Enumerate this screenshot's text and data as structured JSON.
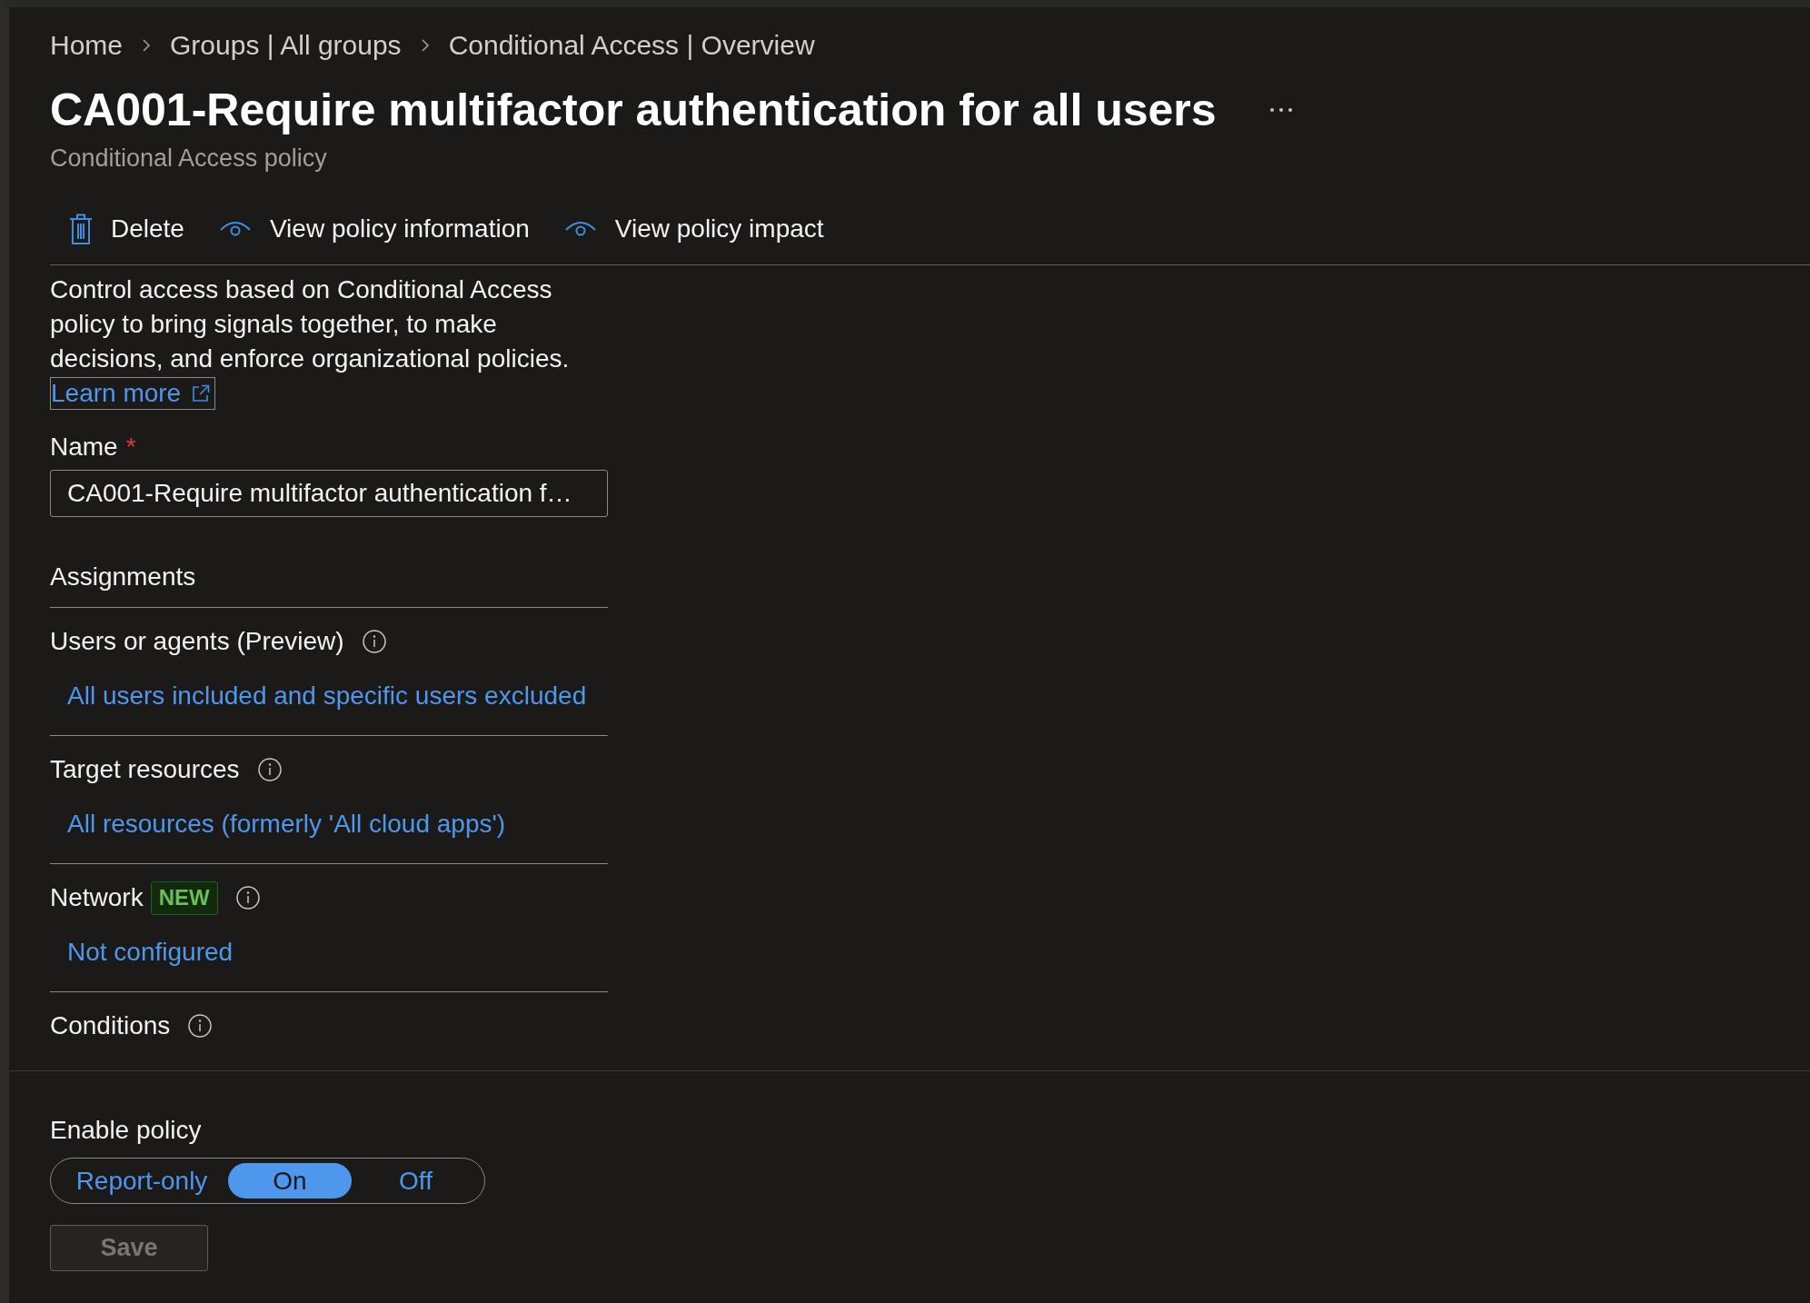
{
  "breadcrumb": [
    "Home",
    "Groups | All groups",
    "Conditional Access | Overview"
  ],
  "header": {
    "title": "CA001-Require multifactor authentication for all users",
    "subtitle": "Conditional Access policy"
  },
  "toolbar": [
    {
      "kind": "delete",
      "label": "Delete"
    },
    {
      "kind": "view",
      "label": "View policy information"
    },
    {
      "kind": "view",
      "label": "View policy impact"
    }
  ],
  "description": {
    "text": "Control access based on Conditional Access policy to bring signals together, to make decisions, and enforce organizational policies.",
    "learn_more": {
      "label": "Learn more",
      "focused": true
    }
  },
  "name_field": {
    "label": "Name",
    "required_mark": "*",
    "value": "CA001-Require multifactor authentication f…"
  },
  "assignments": {
    "heading": "Assignments",
    "items": [
      {
        "label": "Users or agents (Preview)",
        "value": "All users included and specific users excluded"
      },
      {
        "label": "Target resources",
        "value": "All resources (formerly 'All cloud apps')"
      },
      {
        "label": "Network",
        "badge": "NEW",
        "value": "Not configured"
      },
      {
        "label": "Conditions"
      }
    ]
  },
  "enable_policy": {
    "label": "Enable policy",
    "options": [
      {
        "label": "Report-only",
        "selected": false
      },
      {
        "label": "On",
        "selected": true
      },
      {
        "label": "Off",
        "selected": false
      }
    ]
  },
  "save_button": {
    "label": "Save",
    "disabled": true
  }
}
